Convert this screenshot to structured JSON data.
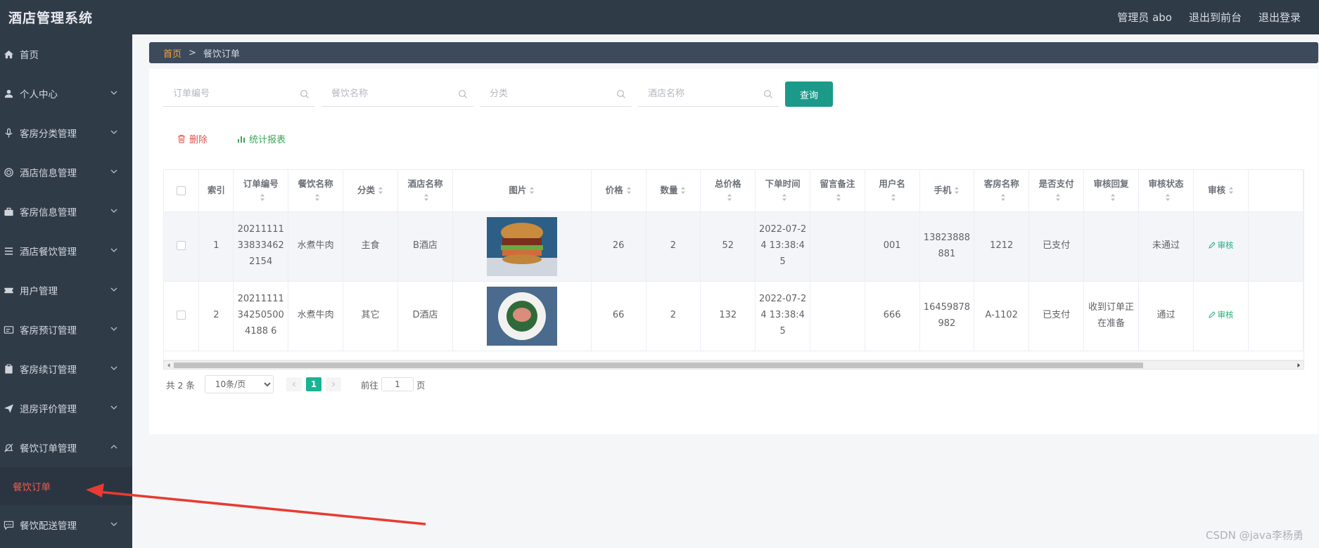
{
  "header": {
    "title": "酒店管理系统",
    "admin": "管理员 abo",
    "to_front": "退出到前台",
    "logout": "退出登录"
  },
  "sidebar": {
    "items": [
      {
        "label": "首页",
        "icon": "home-icon"
      },
      {
        "label": "个人中心",
        "icon": "user-icon"
      },
      {
        "label": "客房分类管理",
        "icon": "microphone-icon"
      },
      {
        "label": "酒店信息管理",
        "icon": "globe-icon"
      },
      {
        "label": "客房信息管理",
        "icon": "briefcase-icon"
      },
      {
        "label": "酒店餐饮管理",
        "icon": "list-icon"
      },
      {
        "label": "用户管理",
        "icon": "ticket-icon"
      },
      {
        "label": "客房预订管理",
        "icon": "card-icon"
      },
      {
        "label": "客房续订管理",
        "icon": "clipboard-icon"
      },
      {
        "label": "退房评价管理",
        "icon": "send-icon"
      },
      {
        "label": "餐饮订单管理",
        "icon": "bell-icon"
      },
      {
        "label": "餐饮配送管理",
        "icon": "chat-icon"
      }
    ],
    "active_sub": "餐饮订单"
  },
  "breadcrumb": {
    "home": "首页",
    "sep": ">",
    "current": "餐饮订单"
  },
  "search": {
    "order_no_placeholder": "订单编号",
    "food_name_placeholder": "餐饮名称",
    "category_placeholder": "分类",
    "hotel_name_placeholder": "酒店名称",
    "query_label": "查询"
  },
  "actions": {
    "delete": "删除",
    "report": "统计报表"
  },
  "table": {
    "headers": [
      "索引",
      "订单编号",
      "餐饮名称",
      "分类",
      "酒店名称",
      "图片",
      "价格",
      "数量",
      "总价格",
      "下单时间",
      "留言备注",
      "用户名",
      "手机",
      "客房名称",
      "是否支付",
      "审核回复",
      "审核状态",
      "审核"
    ],
    "rows": [
      {
        "index": "1",
        "order_no": "20211111338334622154",
        "food": "水煮牛肉",
        "category": "主食",
        "hotel": "B酒店",
        "image": "burger-photo",
        "price": "26",
        "qty": "2",
        "total": "52",
        "time": "2022-07-24 13:38:45",
        "note": "",
        "username": "001",
        "phone": "13823888881",
        "room": "1212",
        "paid": "已支付",
        "reply": "",
        "status": "未通过",
        "audit": "审核"
      },
      {
        "index": "2",
        "order_no": "20211111342505004188 6",
        "food": "水煮牛肉",
        "category": "其它",
        "hotel": "D酒店",
        "image": "salad-plate-photo",
        "price": "66",
        "qty": "2",
        "total": "132",
        "time": "2022-07-24 13:38:45",
        "note": "",
        "username": "666",
        "phone": "16459878982",
        "room": "A-1102",
        "paid": "已支付",
        "reply": "收到订单正在准备",
        "status": "通过",
        "audit": "审核"
      }
    ]
  },
  "pager": {
    "total": "共 2 条",
    "page_size": "10条/页",
    "current": "1",
    "goto_prefix": "前往",
    "goto_value": "1",
    "goto_suffix": "页"
  },
  "watermark": "CSDN @java李杨勇",
  "colors": {
    "sidebar_bg": "#303b48",
    "accent_teal": "#1b9a8a",
    "active_red": "#f25a4a",
    "breadcrumb_home": "#f3a53a"
  }
}
